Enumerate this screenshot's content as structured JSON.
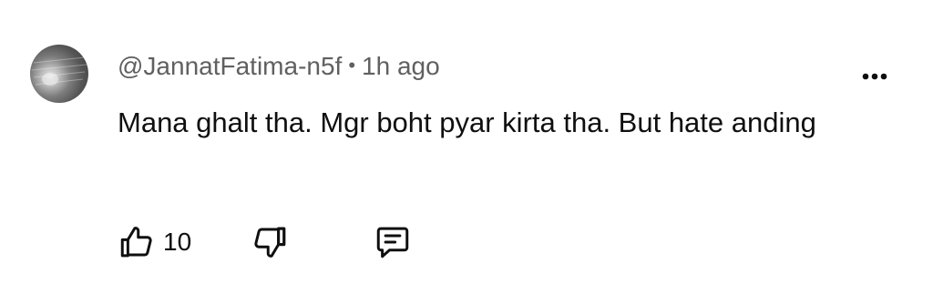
{
  "comment": {
    "author": "@JannatFatima-n5f",
    "separator": "•",
    "time": "1h ago",
    "text": "Mana ghalt tha. Mgr boht pyar kirta tha. But hate anding",
    "like_count": "10"
  },
  "icons": {
    "like": "thumbs-up-icon",
    "dislike": "thumbs-down-icon",
    "reply": "reply-comment-icon",
    "more": "more-vertical-dots-icon"
  },
  "colors": {
    "text_primary": "#0f0f0f",
    "text_secondary": "#606060",
    "background": "#ffffff"
  }
}
